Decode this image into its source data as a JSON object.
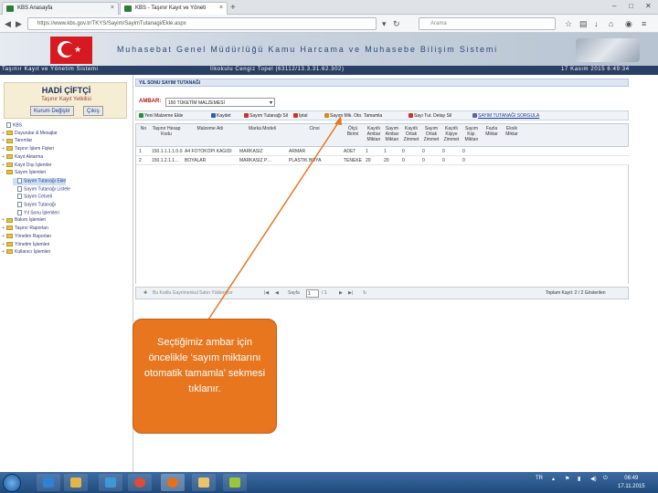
{
  "browser": {
    "tabs": [
      {
        "title": "KBS Anasayfa"
      },
      {
        "title": "KBS - Taşınır Kayıt ve Yöneti"
      }
    ],
    "url": "https://www.kbs.gov.tr/TKYS/Sayim/SayimTutanagi/Ekle.aspx",
    "search_placeholder": "Arama"
  },
  "banner": {
    "title": "Muhasebat Genel Müdürlüğü Kamu Harcama ve Muhasebe Bilişim Sistemi"
  },
  "infobar": {
    "system": "Taşınır Kayıt ve Yönetim Sistemi",
    "unit": "İlkokulu Cengiz Topel (63112/13.3.31.62.302)",
    "datetime": "17 Kasım 2015 6:49:34"
  },
  "user": {
    "name": "HADİ ÇİFTÇİ",
    "role": "Taşınır Kayıt Yetkilisi",
    "change_unit": "Kurum Değiştir",
    "logout": "Çıkış"
  },
  "tree": [
    {
      "label": "KBS",
      "level": 0,
      "type": "doc"
    },
    {
      "label": "Duyurular & Mesajlar",
      "level": 0,
      "type": "folder",
      "toggle": "+"
    },
    {
      "label": "Tanımlar",
      "level": 0,
      "type": "folder",
      "toggle": "+"
    },
    {
      "label": "Taşınır İşlem Fişleri",
      "level": 0,
      "type": "folder",
      "toggle": "+"
    },
    {
      "label": "Kayıt Aktarma",
      "level": 0,
      "type": "folder",
      "toggle": "+"
    },
    {
      "label": "Kayıt Dışı İşlemler",
      "level": 0,
      "type": "folder",
      "toggle": "+"
    },
    {
      "label": "Sayım İşlemleri",
      "level": 0,
      "type": "folder",
      "toggle": "-"
    },
    {
      "label": "Sayım Tutanağı Ekle",
      "level": 1,
      "type": "doc",
      "selected": true
    },
    {
      "label": "Sayım Tutanağı Listele",
      "level": 1,
      "type": "doc"
    },
    {
      "label": "Sayım Cetveli",
      "level": 1,
      "type": "doc"
    },
    {
      "label": "Sayım Tutanağı",
      "level": 1,
      "type": "doc"
    },
    {
      "label": "Yıl Sonu İşlemleri",
      "level": 1,
      "type": "doc"
    },
    {
      "label": "Bakım İşlemleri",
      "level": 0,
      "type": "folder",
      "toggle": "+"
    },
    {
      "label": "Taşınır Raporları",
      "level": 0,
      "type": "folder",
      "toggle": "+"
    },
    {
      "label": "Yönetim Raporları",
      "level": 0,
      "type": "folder",
      "toggle": "+"
    },
    {
      "label": "Yönetim İşlemleri",
      "level": 0,
      "type": "folder",
      "toggle": "+"
    },
    {
      "label": "Kullanıcı İşlemleri",
      "level": 0,
      "type": "folder",
      "toggle": "+"
    }
  ],
  "page": {
    "title": "YIL SONU SAYIM TUTANAĞI",
    "ambar_label": "AMBAR:",
    "ambar_value": "150 TÜKETİM MALZEMESİ"
  },
  "toolbar": [
    {
      "label": "Yeni Malzeme Ekle",
      "color": "#2e8b3a"
    },
    {
      "label": "Kaydet",
      "color": "#2f5fb0"
    },
    {
      "label": "Sayım Tutanağı Sil",
      "color": "#c0392b"
    },
    {
      "label": "İptal",
      "color": "#c0392b"
    },
    {
      "label": "Sayım Mik. Oto. Tamamla",
      "color": "#d98a1c"
    },
    {
      "label": "Sayı Tut. Detay Sil",
      "color": "#c0392b"
    },
    {
      "label": "SAYIM TUTANAĞI SORGULA",
      "color": "#5566aa",
      "link": true
    }
  ],
  "columns": [
    "No",
    "Taşınır Hesap Kodu",
    "Malzeme Adı",
    "Marka Modeli",
    "Cinsi",
    "Ölçü Birimi",
    "Kayıtlı Ambar Miktarı",
    "Sayım Ambar Miktarı",
    "Kayıtlı Ortak Zimmet",
    "Sayım Ortak Zimmet",
    "Kayıtlı Kişiye Zimmet",
    "Sayım Kişi. Miktarı",
    "Fazla Miktar",
    "Eksik Miktar"
  ],
  "rows": [
    [
      "1",
      "150.1.1.1.1.0.0.3…",
      "A4 FOTOKOPİ KAĞIDI",
      "MARKASIZ",
      "ARMAR",
      "ADET",
      "1",
      "1",
      "0",
      "0",
      "0",
      "0",
      "",
      ""
    ],
    [
      "2",
      "150.1.2.1.1…",
      "BOYALAR",
      "MARKASIZ P…",
      "PLASTİK BOYA",
      "TENEKE",
      "20",
      "20",
      "0",
      "0",
      "0",
      "0",
      "",
      ""
    ]
  ],
  "pager": {
    "add_label": "Bu Kodlu Gayrimenkul Satırı Yükleniyor",
    "page_label": "Sayfa",
    "page_value": "1",
    "page_of": "/ 1",
    "summary": "Toplam Kayıt: 2 / 2 Gösterilen"
  },
  "callout": {
    "text": "Seçtiğimiz ambar için öncelikle ‘sayım miktarını otomatik tamamla’ sekmesi tıklanır."
  },
  "taskbar": {
    "lang": "TR",
    "time": "06:49",
    "date": "17.11.2015"
  }
}
